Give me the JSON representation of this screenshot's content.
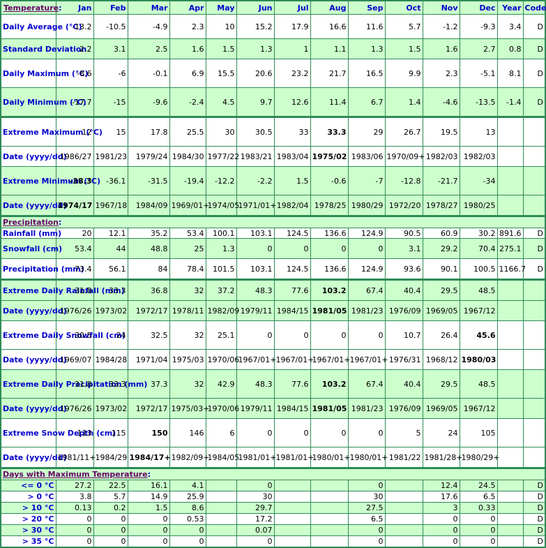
{
  "header": {
    "section_label": "Temperature",
    "columns": [
      "Jan",
      "Feb",
      "Mar",
      "Apr",
      "May",
      "Jun",
      "Jul",
      "Aug",
      "Sep",
      "Oct",
      "Nov",
      "Dec",
      "Year",
      "Code"
    ]
  },
  "temperature": [
    {
      "label": "Daily Average (°C)",
      "values": [
        "-13.2",
        "-10.5",
        "-4.9",
        "2.3",
        "10",
        "15.2",
        "17.9",
        "16.6",
        "11.6",
        "5.7",
        "-1.2",
        "-9.3",
        "3.4",
        "D"
      ],
      "shade": "w"
    },
    {
      "label": "Standard Deviation",
      "values": [
        "2.2",
        "3.1",
        "2.5",
        "1.6",
        "1.5",
        "1.3",
        "1",
        "1.1",
        "1.3",
        "1.5",
        "1.6",
        "2.7",
        "0.8",
        "D"
      ],
      "shade": "g"
    },
    {
      "label": "Daily Maximum (°C)",
      "values": [
        "-8.6",
        "-6",
        "-0.1",
        "6.9",
        "15.5",
        "20.6",
        "23.2",
        "21.7",
        "16.5",
        "9.9",
        "2.3",
        "-5.1",
        "8.1",
        "D"
      ],
      "shade": "w"
    },
    {
      "label": "Daily Minimum (°C)",
      "values": [
        "-17.7",
        "-15",
        "-9.6",
        "-2.4",
        "4.5",
        "9.7",
        "12.6",
        "11.4",
        "6.7",
        "1.4",
        "-4.6",
        "-13.5",
        "-1.4",
        "D"
      ],
      "shade": "g"
    },
    {
      "label": "Extreme Maximum (°C)",
      "values": [
        "12",
        "15",
        "17.8",
        "25.5",
        "30",
        "30.5",
        "33",
        "33.3",
        "29",
        "26.7",
        "19.5",
        "13",
        "",
        ""
      ],
      "bold": [
        7
      ],
      "shade": "w",
      "groupstart": true
    },
    {
      "label": "Date (yyyy/dd)",
      "values": [
        "1986/27",
        "1981/23",
        "1979/24",
        "1984/30",
        "1977/22",
        "1983/21",
        "1983/04",
        "1975/02",
        "1983/06",
        "1970/09+",
        "1982/03",
        "1982/03",
        "",
        ""
      ],
      "bold": [
        7
      ],
      "shade": "w"
    },
    {
      "label": "Extreme Minimum (°C)",
      "values": [
        "-38.3",
        "-36.1",
        "-31.5",
        "-19.4",
        "-12.2",
        "-2.2",
        "1.5",
        "-0.6",
        "-7",
        "-12.8",
        "-21.7",
        "-34",
        "",
        ""
      ],
      "bold": [
        0
      ],
      "shade": "g"
    },
    {
      "label": "Date (yyyy/dd)",
      "values": [
        "1974/17",
        "1967/18",
        "1984/09",
        "1969/01+",
        "1974/05",
        "1971/01+",
        "1982/04",
        "1978/25",
        "1980/29",
        "1972/20",
        "1978/27",
        "1980/25",
        "",
        ""
      ],
      "bold": [
        0
      ],
      "shade": "g"
    }
  ],
  "precipitation_section_label": "Precipitation",
  "precipitation": [
    {
      "label": "Rainfall (mm)",
      "values": [
        "20",
        "12.1",
        "35.2",
        "53.4",
        "100.1",
        "103.1",
        "124.5",
        "136.6",
        "124.9",
        "90.5",
        "60.9",
        "30.2",
        "891.6",
        "D"
      ],
      "shade": "w"
    },
    {
      "label": "Snowfall (cm)",
      "values": [
        "53.4",
        "44",
        "48.8",
        "25",
        "1.3",
        "0",
        "0",
        "0",
        "0",
        "3.1",
        "29.2",
        "70.4",
        "275.1",
        "D"
      ],
      "shade": "g"
    },
    {
      "label": "Precipitation (mm)",
      "values": [
        "73.4",
        "56.1",
        "84",
        "78.4",
        "101.5",
        "103.1",
        "124.5",
        "136.6",
        "124.9",
        "93.6",
        "90.1",
        "100.5",
        "1166.7",
        "D"
      ],
      "shade": "w"
    },
    {
      "label": "Extreme Daily Rainfall (mm)",
      "values": [
        "31.8",
        "33.3",
        "36.8",
        "32",
        "37.2",
        "48.3",
        "77.6",
        "103.2",
        "67.4",
        "40.4",
        "29.5",
        "48.5",
        "",
        ""
      ],
      "bold": [
        7
      ],
      "shade": "g",
      "groupstart": true
    },
    {
      "label": "Date (yyyy/dd)",
      "values": [
        "1976/26",
        "1973/02",
        "1972/17",
        "1978/11",
        "1982/09",
        "1979/11",
        "1984/15",
        "1981/05",
        "1981/23",
        "1976/09",
        "1969/05",
        "1967/12",
        "",
        ""
      ],
      "bold": [
        7
      ],
      "shade": "g"
    },
    {
      "label": "Extreme Daily Snowfall (cm)",
      "values": [
        "30.5",
        "24",
        "32.5",
        "32",
        "25.1",
        "0",
        "0",
        "0",
        "0",
        "10.7",
        "26.4",
        "45.6",
        "",
        ""
      ],
      "bold": [
        11
      ],
      "shade": "w"
    },
    {
      "label": "Date (yyyy/dd)",
      "values": [
        "1969/07",
        "1984/28",
        "1971/04",
        "1975/03",
        "1970/06",
        "1967/01+",
        "1967/01+",
        "1967/01+",
        "1967/01+",
        "1976/31",
        "1968/12",
        "1980/03",
        "",
        ""
      ],
      "bold": [
        11
      ],
      "shade": "w"
    },
    {
      "label": "Extreme Daily Precipitation (mm)",
      "values": [
        "31.8",
        "33.3",
        "37.3",
        "32",
        "42.9",
        "48.3",
        "77.6",
        "103.2",
        "67.4",
        "40.4",
        "29.5",
        "48.5",
        "",
        ""
      ],
      "bold": [
        7
      ],
      "shade": "g"
    },
    {
      "label": "Date (yyyy/dd)",
      "values": [
        "1976/26",
        "1973/02",
        "1972/17",
        "1975/03+",
        "1970/06",
        "1979/11",
        "1984/15",
        "1981/05",
        "1981/23",
        "1976/09",
        "1969/05",
        "1967/12",
        "",
        ""
      ],
      "bold": [
        7
      ],
      "shade": "g"
    },
    {
      "label": "Extreme Snow Depth (cm)",
      "values": [
        "113",
        "115",
        "150",
        "146",
        "6",
        "0",
        "0",
        "0",
        "0",
        "5",
        "24",
        "105",
        "",
        ""
      ],
      "bold": [
        2
      ],
      "shade": "w"
    },
    {
      "label": "Date (yyyy/dd)",
      "values": [
        "1981/11+",
        "1984/29",
        "1984/17+",
        "1982/09+",
        "1984/05",
        "1981/01+",
        "1981/01+",
        "1980/01+",
        "1980/01+",
        "1981/22",
        "1981/28+",
        "1980/29+",
        "",
        ""
      ],
      "bold": [
        2
      ],
      "shade": "w"
    }
  ],
  "days_section_label": "Days with Maximum Temperature",
  "days_max_temp": [
    {
      "label": "<= 0 °C",
      "values": [
        "27.2",
        "22.5",
        "16.1",
        "4.1",
        "",
        "0",
        "",
        "",
        "0",
        "",
        "12.4",
        "24.5",
        "",
        "D"
      ],
      "shade": "g"
    },
    {
      "label": "> 0 °C",
      "values": [
        "3.8",
        "5.7",
        "14.9",
        "25.9",
        "",
        "30",
        "",
        "",
        "30",
        "",
        "17.6",
        "6.5",
        "",
        "D"
      ],
      "shade": "w"
    },
    {
      "label": "> 10 °C",
      "values": [
        "0.13",
        "0.2",
        "1.5",
        "8.6",
        "",
        "29.7",
        "",
        "",
        "27.5",
        "",
        "3",
        "0.33",
        "",
        "D"
      ],
      "shade": "g"
    },
    {
      "label": "> 20 °C",
      "values": [
        "0",
        "0",
        "0",
        "0.53",
        "",
        "17.2",
        "",
        "",
        "6.5",
        "",
        "0",
        "0",
        "",
        "D"
      ],
      "shade": "w"
    },
    {
      "label": "> 30 °C",
      "values": [
        "0",
        "0",
        "0",
        "0",
        "",
        "0.07",
        "",
        "",
        "0",
        "",
        "0",
        "0",
        "",
        "D"
      ],
      "shade": "g"
    },
    {
      "label": "> 35 °C",
      "values": [
        "0",
        "0",
        "0",
        "0",
        "",
        "0",
        "",
        "",
        "0",
        "",
        "0",
        "0",
        "",
        "D"
      ],
      "shade": "w"
    }
  ],
  "colors": {
    "border": "#2e8b57",
    "shaded_row": "#ccffcc",
    "label_text": "#0000cc",
    "section_link": "#660066"
  }
}
